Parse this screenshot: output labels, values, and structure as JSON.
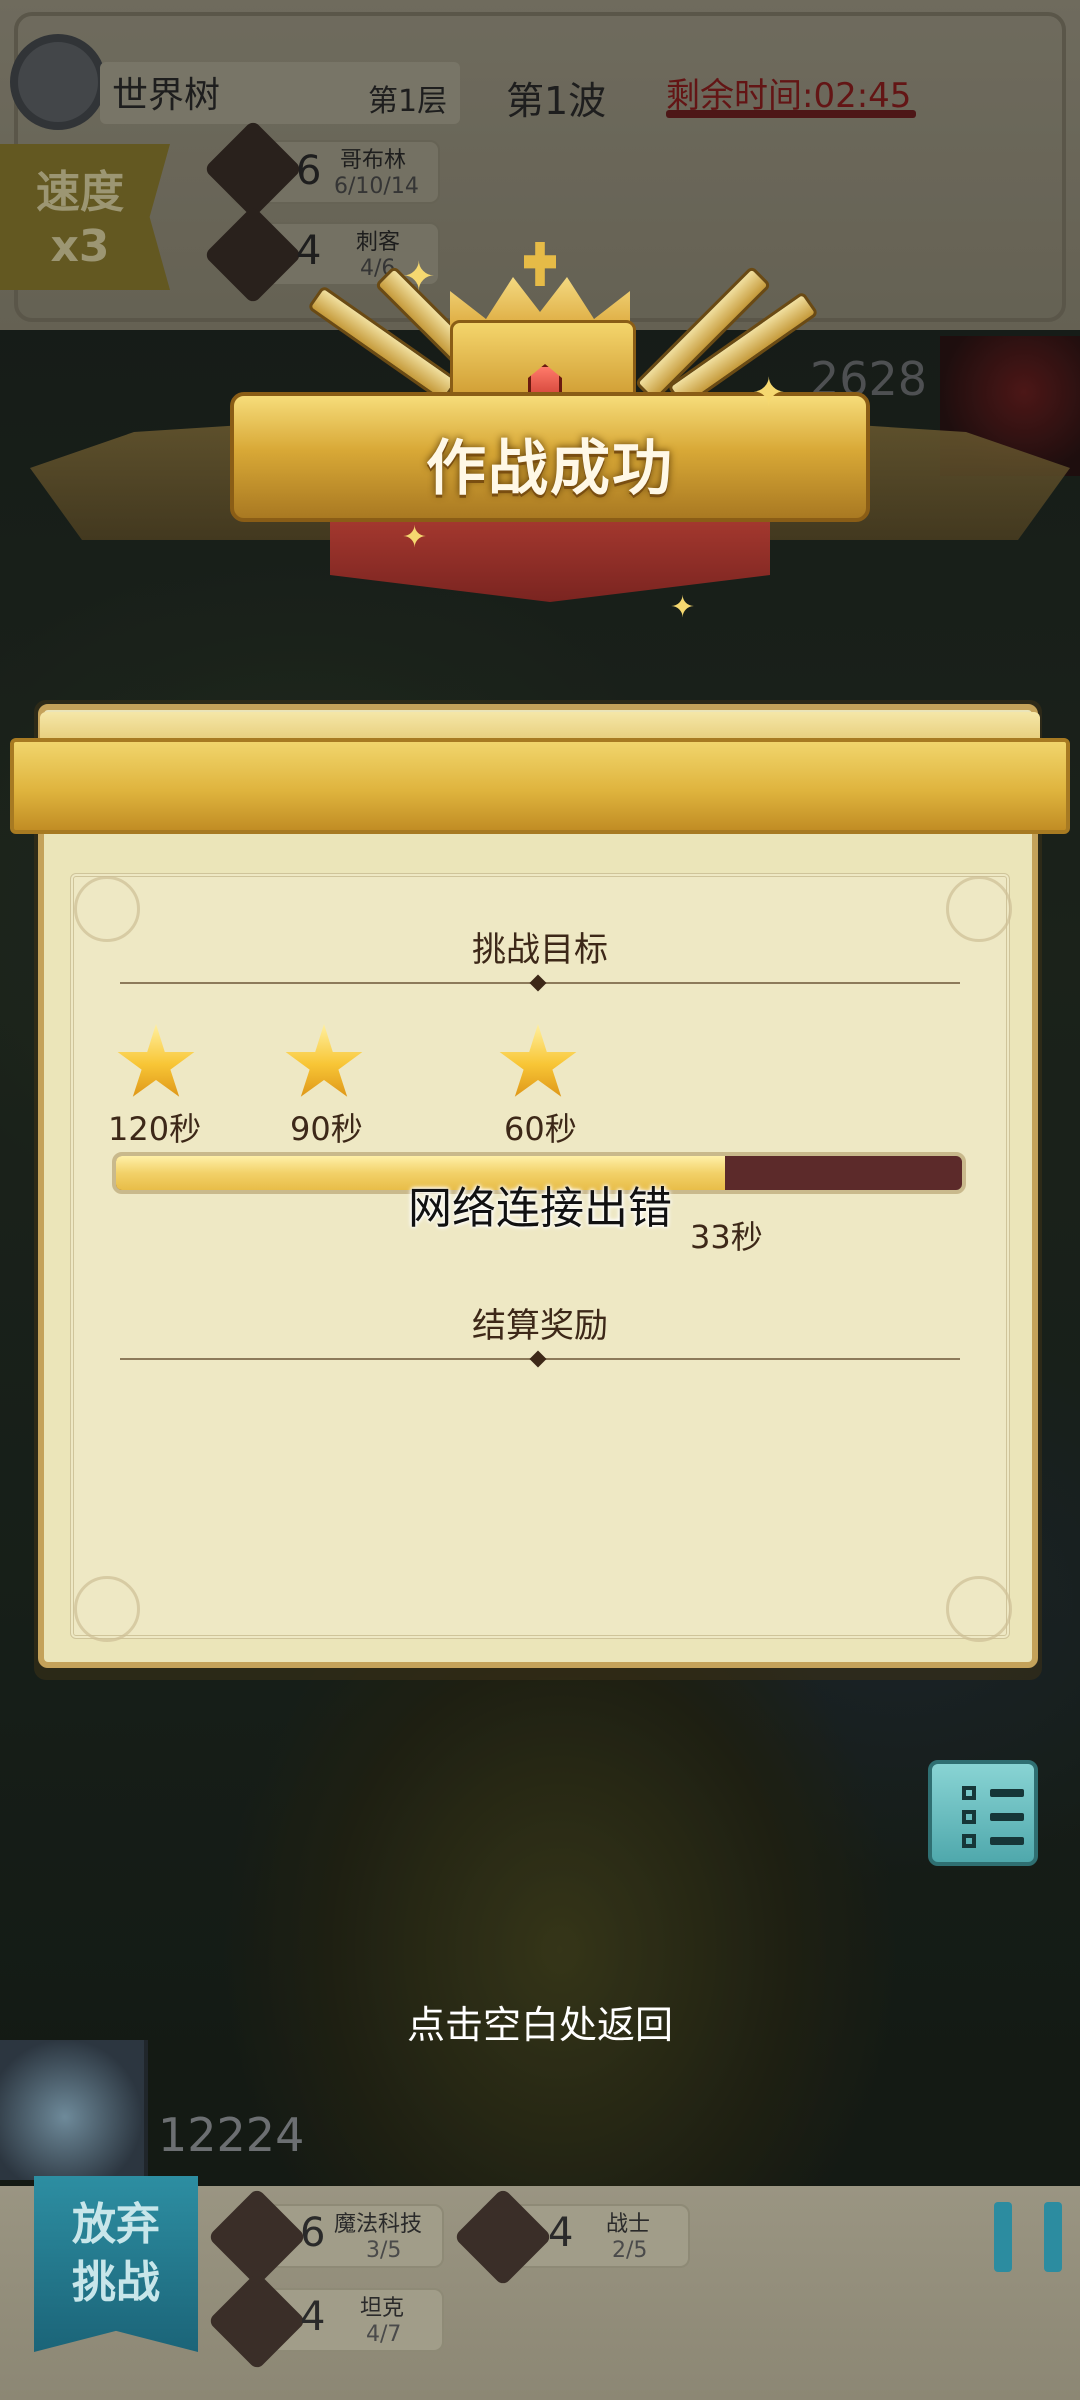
{
  "hud": {
    "stage_name": "世界树",
    "floor": "第1层",
    "wave": "第1波",
    "time_remaining": "剩余时间:02:45",
    "speed_line1": "速度",
    "speed_line2": "x3",
    "top_synergies": [
      {
        "icon": "goblin-icon",
        "count": "6",
        "name": "哥布林",
        "progress": "6/10/14"
      },
      {
        "icon": "assassin-icon",
        "count": "4",
        "name": "刺客",
        "progress": "4/6"
      }
    ],
    "enemy_score": "2628"
  },
  "banner": {
    "title": "作战成功"
  },
  "panel": {
    "challenge_title": "挑战目标",
    "stars": [
      {
        "label": "120秒"
      },
      {
        "label": "90秒"
      },
      {
        "label": "60秒"
      }
    ],
    "progress_fraction": 0.72,
    "elapsed": "33秒",
    "network_error": "网络连接出错",
    "reward_title": "结算奖励"
  },
  "return_hint": "点击空白处返回",
  "player": {
    "score": "12224"
  },
  "bottom": {
    "quit_line1": "放弃",
    "quit_line2": "挑战",
    "synergies": [
      {
        "icon": "magitech-icon",
        "count": "6",
        "name": "魔法科技",
        "progress": "3/5"
      },
      {
        "icon": "warrior-icon",
        "count": "4",
        "name": "战士",
        "progress": "2/5"
      },
      {
        "icon": "tank-icon",
        "count": "4",
        "name": "坦克",
        "progress": "4/7"
      }
    ]
  },
  "colors": {
    "panel_bg": "#ebe5b9",
    "gold": "#dfb43e",
    "progress_fill": "#f2d169",
    "progress_track": "#5c2a2a",
    "teal_button": "#4fa8ac"
  }
}
